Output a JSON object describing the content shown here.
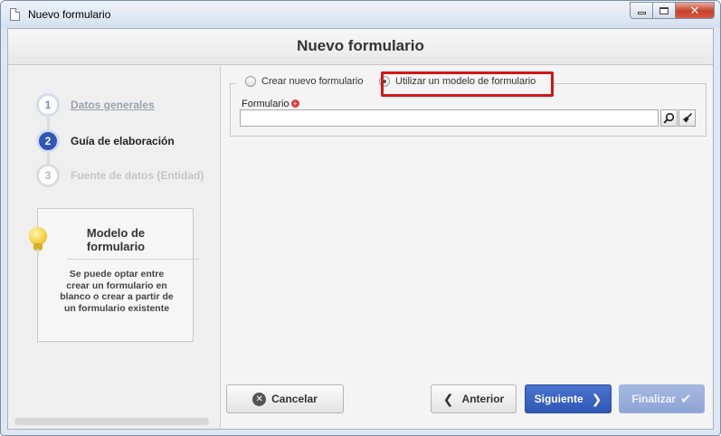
{
  "window": {
    "title": "Nuevo formulario"
  },
  "header": {
    "title": "Nuevo formulario"
  },
  "steps": [
    {
      "number": "1",
      "label": "Datos generales",
      "state": "done"
    },
    {
      "number": "2",
      "label": "Guía de elaboración",
      "state": "active"
    },
    {
      "number": "3",
      "label": "Fuente de datos (Entidad)",
      "state": "future"
    }
  ],
  "tip": {
    "title": "Modelo de formulario",
    "body": "Se puede optar entre crear un formulario en blanco o crear a partir de un formulario existente"
  },
  "options": {
    "new_form": "Crear nuevo formulario",
    "use_model": "Utilizar un modelo de formulario",
    "selected": "use_model"
  },
  "form_field": {
    "label": "Formulario",
    "value": ""
  },
  "buttons": {
    "cancel": "Cancelar",
    "previous": "Anterior",
    "next": "Siguiente",
    "finish": "Finalizar"
  },
  "colors": {
    "primary": "#2f57b5",
    "highlight": "#d41515",
    "required": "#e13c3c"
  }
}
